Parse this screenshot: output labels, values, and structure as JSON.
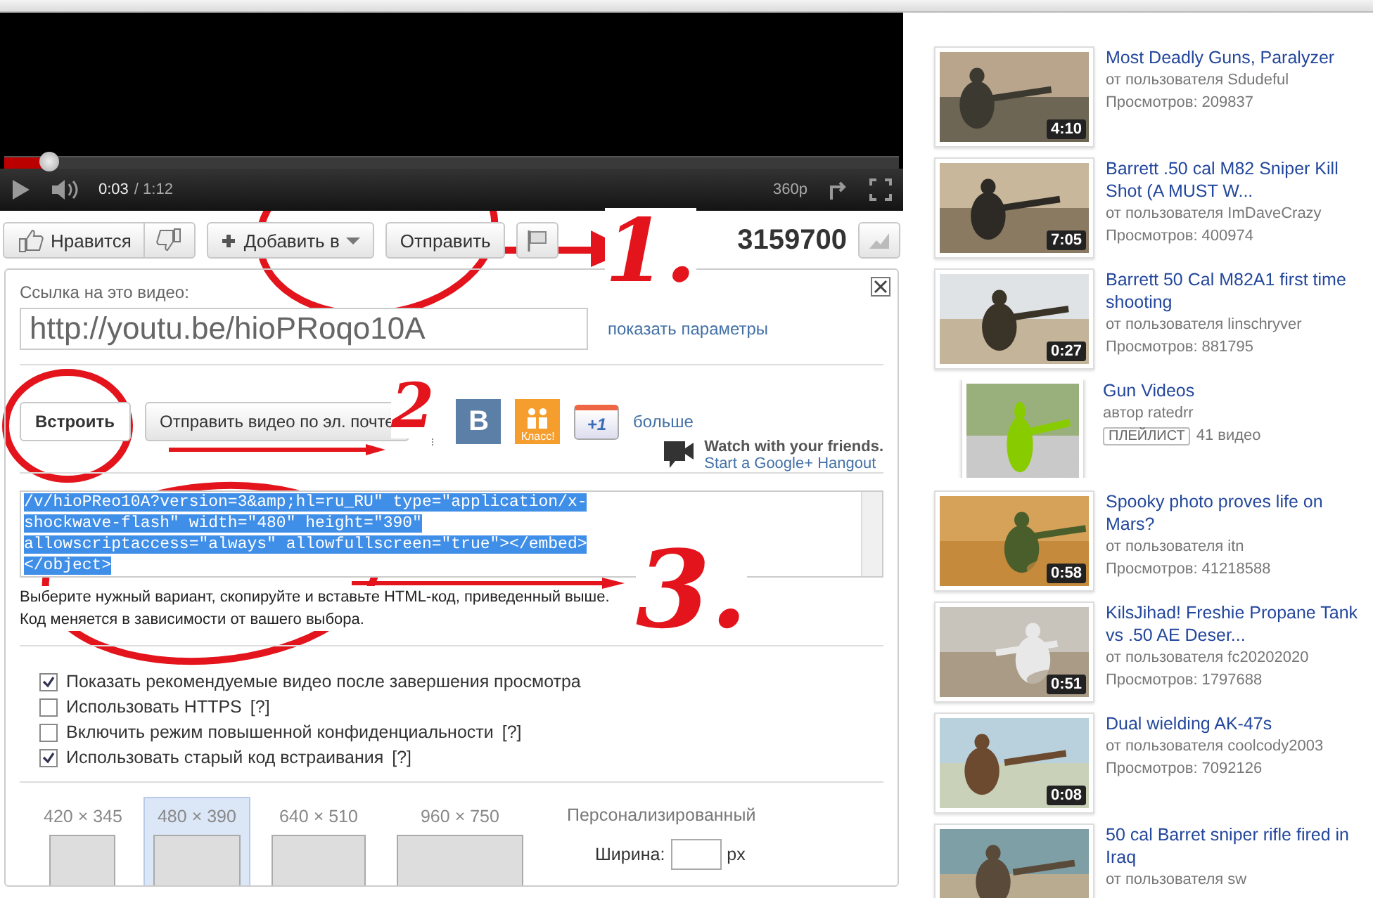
{
  "player": {
    "level": 0.05,
    "time_current": "0:03",
    "time_total": "/ 1:12",
    "quality": "360p"
  },
  "actions": {
    "like": "Нравится",
    "add": "Добавить в",
    "send": "Отправить",
    "views": "3159700"
  },
  "share": {
    "link_label": "Ссылка на это видео:",
    "link_value": "http://youtu.be/hioPRoqo10A",
    "show_options": "показать параметры",
    "tabs": [
      {
        "label": "Встроить",
        "selected": true
      },
      {
        "label": "Отправить видео по эл. почте",
        "selected": false
      }
    ],
    "social": {
      "vk": "В",
      "ok": "Класс!",
      "plus": "+1",
      "more": "больше"
    },
    "hangout": {
      "title": "Watch with your friends.",
      "link": "Start a Google+ Hangout"
    },
    "code_lines": [
      "/v/hioPReo10A?version=3&amp;hl=ru_RU\" type=\"application/x-",
      "shockwave-flash\" width=\"480\" height=\"390\"",
      "allowscriptaccess=\"always\" allowfullscreen=\"true\"></embed>",
      "</object>"
    ],
    "hint": "Выберите нужный вариант, скопируйте и вставьте HTML-код, приведенный выше. Код меняется в зависимости от вашего выбора.",
    "options": [
      {
        "label": "Показать рекомендуемые видео после завершения просмотра",
        "checked": true
      },
      {
        "label": "Использовать HTTPS",
        "help": "[?]",
        "checked": false
      },
      {
        "label": "Включить режим повышенной конфиденциальности",
        "help": "[?]",
        "checked": false
      },
      {
        "label": "Использовать старый код встраивания",
        "help": "[?]",
        "checked": true
      }
    ],
    "sizes": [
      {
        "label": "420 × 345",
        "selected": false
      },
      {
        "label": "480 × 390",
        "selected": true
      },
      {
        "label": "640 × 510",
        "selected": false
      },
      {
        "label": "960 × 750",
        "selected": false
      }
    ],
    "custom": {
      "label": "Персонализированный",
      "width_label": "Ширина:",
      "unit": "px"
    }
  },
  "sidebar": [
    {
      "kind": "video",
      "title": "Most Deadly Guns, Paralyzer",
      "meta": "от пользователя Sdudeful",
      "views": "Просмотров: 209837",
      "duration": "4:10"
    },
    {
      "kind": "video",
      "title": "Barrett .50 cal M82 Sniper Kill Shot (A MUST W...",
      "meta": "от пользователя ImDaveCrazy",
      "views": "Просмотров: 400974",
      "duration": "7:05"
    },
    {
      "kind": "video",
      "title": "Barrett 50 Cal M82A1 first time shooting",
      "meta": "от пользователя linschryver",
      "views": "Просмотров: 881795",
      "duration": "0:27"
    },
    {
      "kind": "playlist",
      "title": "Gun Videos",
      "meta": "автор ratedrr",
      "badge": "ПЛЕЙЛИСТ",
      "count": "41 видео"
    },
    {
      "kind": "video",
      "title": "Spooky photo proves life on Mars?",
      "meta": "от пользователя itn",
      "views": "Просмотров: 41218588",
      "duration": "0:58"
    },
    {
      "kind": "video",
      "title": "KilsJihad! Freshie Propane Tank vs .50 AE Deser...",
      "meta": "от пользователя fc20202020",
      "views": "Просмотров: 1797688",
      "duration": "0:51"
    },
    {
      "kind": "video",
      "title": "Dual wielding AK-47s",
      "meta": "от пользователя coolcody2003",
      "views": "Просмотров: 7092126",
      "duration": "0:08"
    },
    {
      "kind": "video",
      "title": "50 cal Barret sniper rifle fired in Iraq",
      "meta": "от пользователя sw"
    }
  ],
  "annotations": [
    {
      "label": "1."
    },
    {
      "label": "2"
    },
    {
      "label": "3."
    }
  ]
}
